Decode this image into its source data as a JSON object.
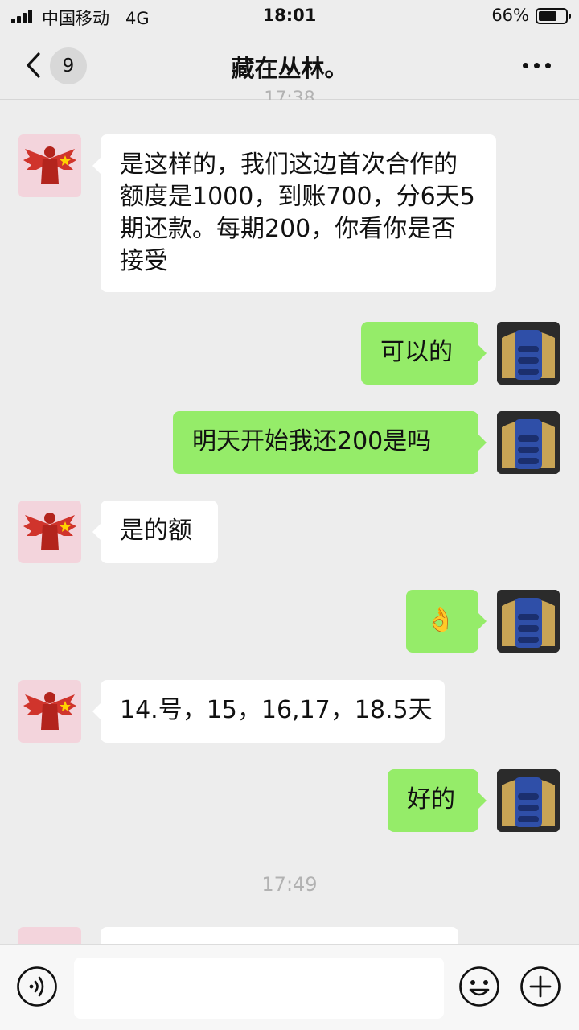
{
  "status_bar": {
    "carrier": "中国移动",
    "network": "4G",
    "time": "18:01",
    "battery": "66%"
  },
  "nav": {
    "back_icon": "chevron-left-icon",
    "unread_count": "9",
    "title": "藏在丛林。",
    "more_icon": "more-dots-icon"
  },
  "peek_time": "17:38",
  "messages": [
    {
      "side": "left",
      "text": "是这样的，我们这边首次合作的额度是1000，到账700，分6天5期还款。每期200，你看你是否接受"
    },
    {
      "side": "right",
      "text": "可以的"
    },
    {
      "side": "right",
      "text": "明天开始我还200是吗"
    },
    {
      "side": "left",
      "text": "是的额"
    },
    {
      "side": "right",
      "text": "👌"
    },
    {
      "side": "left",
      "text": "14.号，15，16,17，18.5天"
    },
    {
      "side": "right",
      "text": "好的"
    }
  ],
  "time_separator": "17:49",
  "input_bar": {
    "voice_icon": "voice-icon",
    "emoji_icon": "emoji-icon",
    "plus_icon": "plus-icon",
    "placeholder": ""
  },
  "colors": {
    "background": "#ededed",
    "sent_bubble": "#95ec69",
    "received_bubble": "#ffffff",
    "timestamp": "#b2b2b2"
  }
}
